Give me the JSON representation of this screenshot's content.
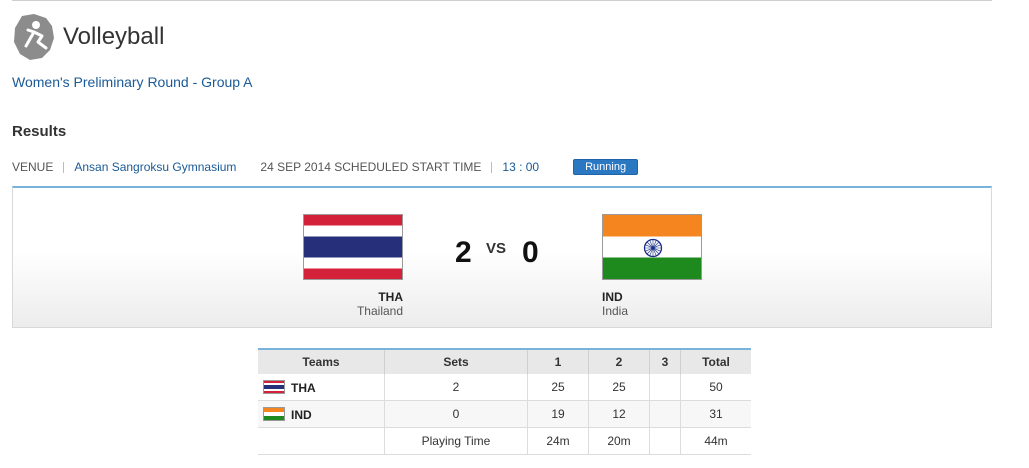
{
  "sport": {
    "title": "Volleyball",
    "icon": "volleyball-pictogram-icon"
  },
  "round": "Women's Preliminary Round - Group A",
  "results_title": "Results",
  "venue": {
    "label": "VENUE",
    "name": "Ansan Sangroksu Gymnasium",
    "date_label": "24 SEP 2014 SCHEDULED START TIME",
    "time": "13 : 00",
    "status": "Running"
  },
  "match": {
    "home": {
      "code": "THA",
      "name": "Thailand",
      "score": "2",
      "flag": "thailand-flag"
    },
    "away": {
      "code": "IND",
      "name": "India",
      "score": "0",
      "flag": "india-flag"
    },
    "vs": "VS"
  },
  "table": {
    "headers": [
      "Teams",
      "Sets",
      "1",
      "2",
      "3",
      "Total"
    ],
    "rows": [
      {
        "team": "THA",
        "flag": "thailand-flag",
        "sets": "2",
        "s1": "25",
        "s2": "25",
        "s3": "",
        "total": "50"
      },
      {
        "team": "IND",
        "flag": "india-flag",
        "sets": "0",
        "s1": "19",
        "s2": "12",
        "s3": "",
        "total": "31"
      }
    ],
    "playing_time": {
      "label": "Playing Time",
      "s1": "24m",
      "s2": "20m",
      "s3": "",
      "total": "44m"
    }
  },
  "colors": {
    "link": "#1a5a96",
    "status_badge": "#2b78c2",
    "accent_rule": "#7ab2de"
  }
}
